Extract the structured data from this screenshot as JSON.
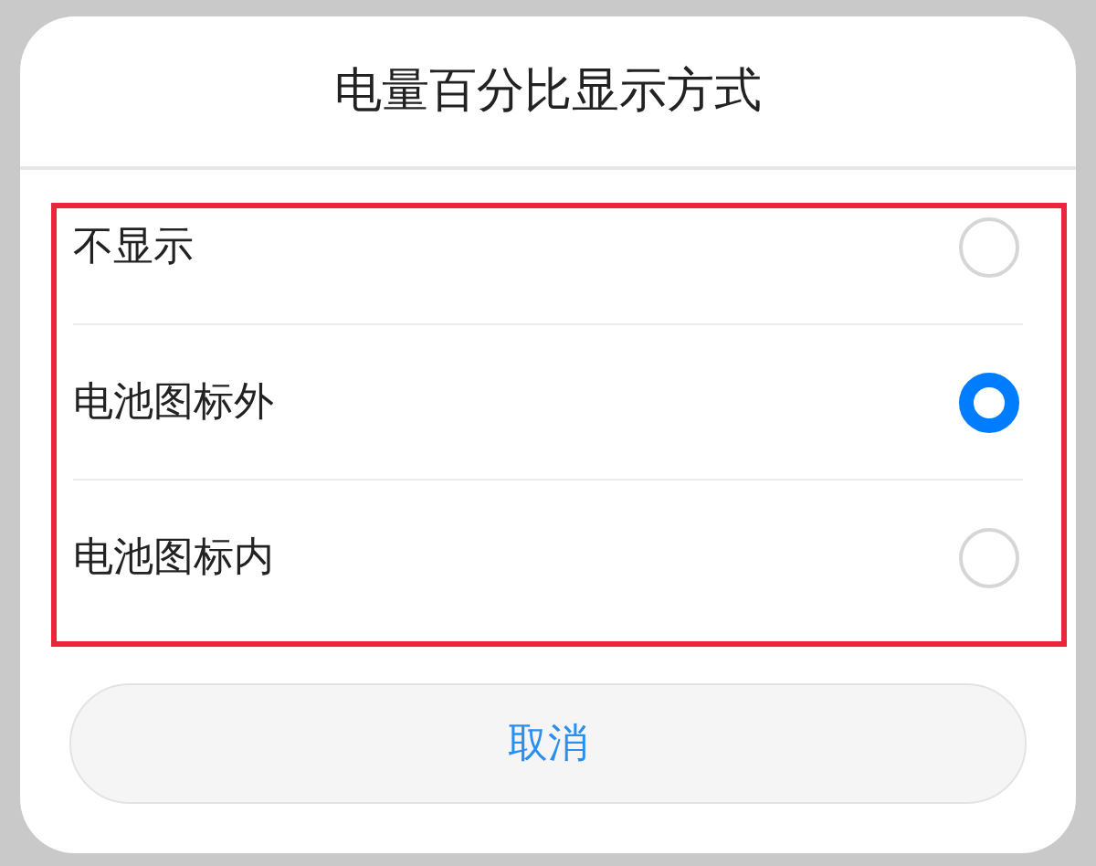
{
  "dialog": {
    "title": "电量百分比显示方式",
    "options": [
      {
        "label": "不显示",
        "selected": false
      },
      {
        "label": "电池图标外",
        "selected": true
      },
      {
        "label": "电池图标内",
        "selected": false
      }
    ],
    "cancel_button": "取消"
  }
}
